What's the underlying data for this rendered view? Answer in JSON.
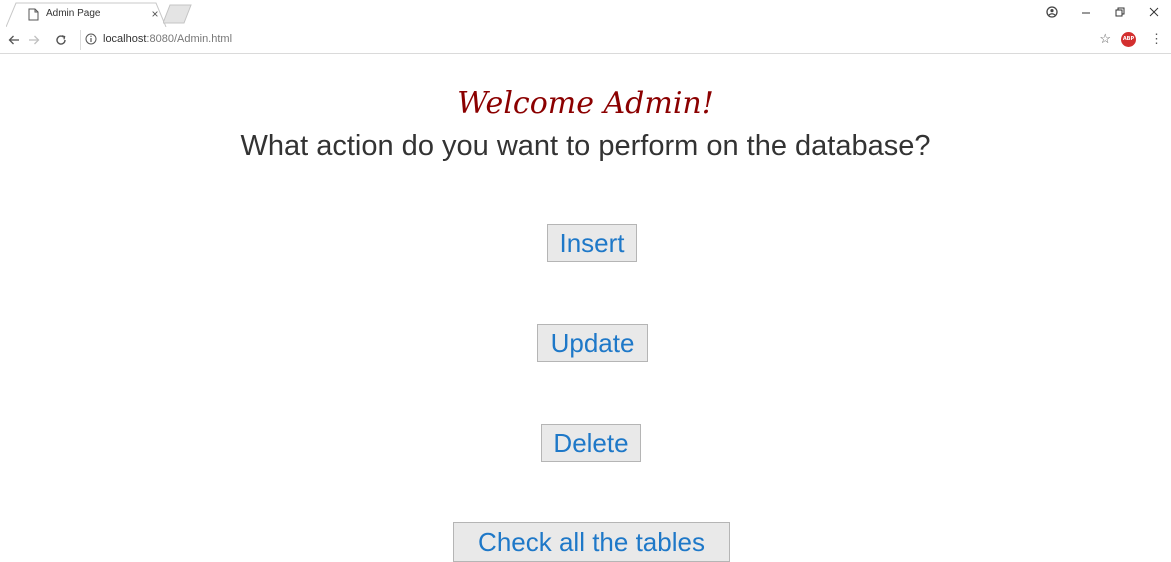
{
  "browser": {
    "tab_title": "Admin Page",
    "tab_close": "×",
    "url_host": "localhost",
    "url_rest": ":8080/Admin.html",
    "icons": [
      "page-icon",
      "close-icon",
      "account-icon",
      "minimize-icon",
      "restore-icon",
      "window-close-icon",
      "back-icon",
      "forward-icon",
      "reload-icon",
      "info-icon",
      "star-icon",
      "adblock-icon",
      "menu-icon"
    ],
    "adblock_label": "ABP"
  },
  "page": {
    "welcome": "Welcome Admin!",
    "question": "What action do you want to perform on the database?",
    "buttons": {
      "insert": "Insert",
      "update": "Update",
      "delete": "Delete",
      "check": "Check all the tables"
    }
  },
  "colors": {
    "welcome": "#8b0000",
    "button_text": "#1e78c8",
    "button_bg": "#e9e9e9"
  }
}
